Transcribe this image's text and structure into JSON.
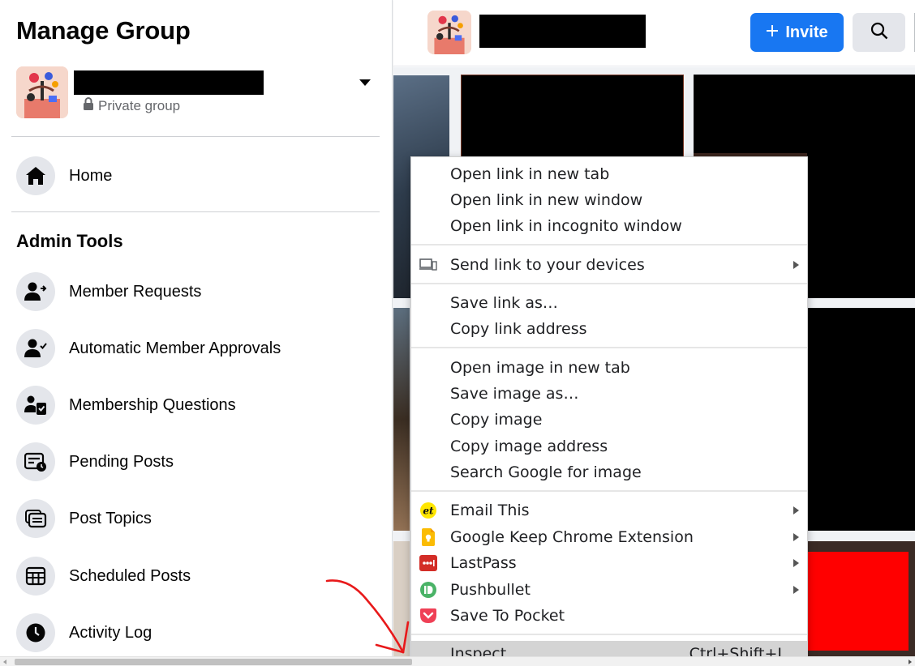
{
  "sidebar": {
    "title": "Manage Group",
    "group": {
      "privacy": "Private group",
      "caret_icon": "caret-down-icon"
    },
    "home": {
      "label": "Home",
      "icon": "home-icon"
    },
    "admin_tools_title": "Admin Tools",
    "items": [
      {
        "label": "Member Requests",
        "icon": "person-arrow-icon"
      },
      {
        "label": "Automatic Member Approvals",
        "icon": "person-check-icon"
      },
      {
        "label": "Membership Questions",
        "icon": "person-clipboard-icon"
      },
      {
        "label": "Pending Posts",
        "icon": "post-clock-icon"
      },
      {
        "label": "Post Topics",
        "icon": "stacked-cards-icon"
      },
      {
        "label": "Scheduled Posts",
        "icon": "calendar-grid-icon"
      },
      {
        "label": "Activity Log",
        "icon": "clock-icon"
      }
    ]
  },
  "header": {
    "invite_label": "Invite",
    "search_icon": "search-icon"
  },
  "context_menu": {
    "groups": [
      {
        "items": [
          {
            "label": "Open link in new tab"
          },
          {
            "label": "Open link in new window"
          },
          {
            "label": "Open link in incognito window"
          }
        ]
      },
      {
        "items": [
          {
            "label": "Send link to your devices",
            "icon": "devices-icon",
            "submenu": true
          }
        ]
      },
      {
        "items": [
          {
            "label": "Save link as…"
          },
          {
            "label": "Copy link address"
          }
        ]
      },
      {
        "items": [
          {
            "label": "Open image in new tab"
          },
          {
            "label": "Save image as…"
          },
          {
            "label": "Copy image"
          },
          {
            "label": "Copy image address"
          },
          {
            "label": "Search Google for image"
          }
        ]
      },
      {
        "items": [
          {
            "label": "Email This",
            "icon": "email-this-icon",
            "submenu": true
          },
          {
            "label": "Google Keep Chrome Extension",
            "icon": "google-keep-icon",
            "submenu": true
          },
          {
            "label": "LastPass",
            "icon": "lastpass-icon",
            "submenu": true
          },
          {
            "label": "Pushbullet",
            "icon": "pushbullet-icon",
            "submenu": true
          },
          {
            "label": "Save To Pocket",
            "icon": "pocket-icon",
            "submenu": false
          }
        ]
      },
      {
        "items": [
          {
            "label": "Inspect",
            "shortcut": "Ctrl+Shift+I",
            "highlighted": true
          }
        ]
      }
    ]
  },
  "colors": {
    "facebook_blue": "#1877f2",
    "annotation_red": "#e8191a",
    "menu_highlight": "#d4d4d4"
  }
}
